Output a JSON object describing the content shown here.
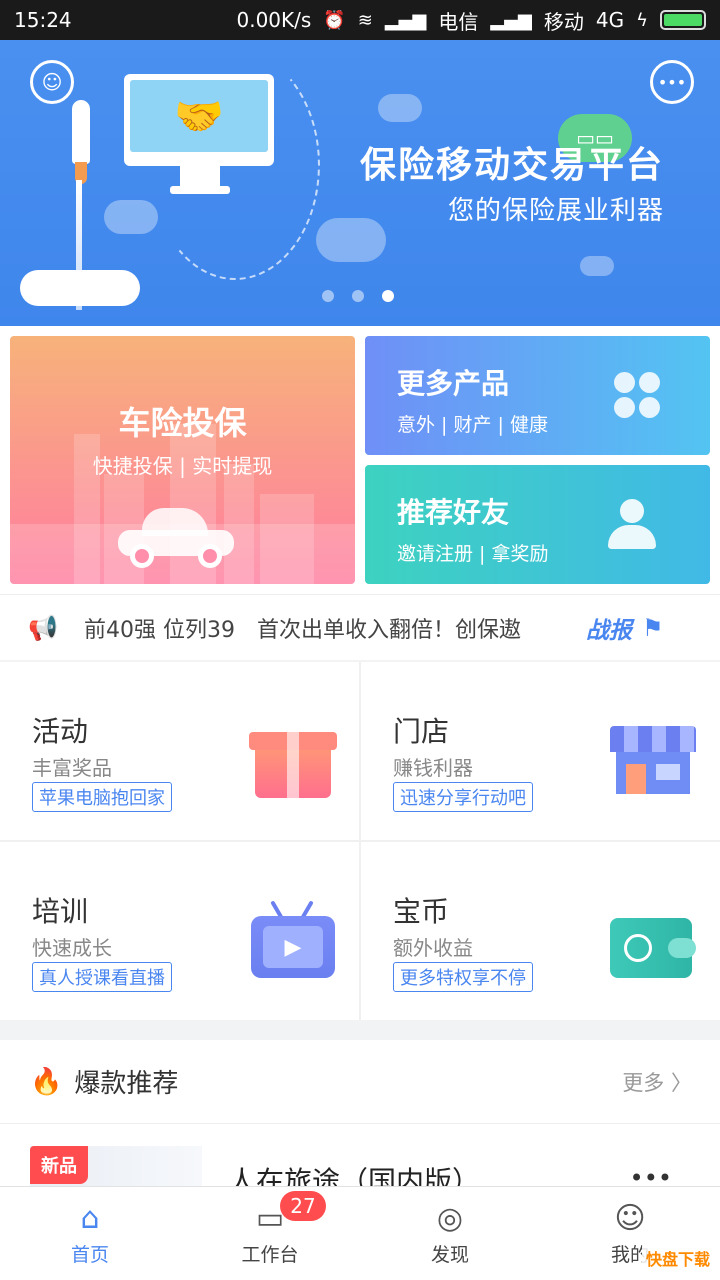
{
  "status_bar": {
    "time": "15:24",
    "speed": "0.00K/s",
    "carrier1": "电信",
    "carrier2": "移动",
    "network": "4G",
    "battery_level": 1.0
  },
  "banner": {
    "title": "保险移动交易平台",
    "subtitle": "您的保险展业利器",
    "page_count": 3,
    "active_page": 3
  },
  "tiles": {
    "car": {
      "title": "车险投保",
      "subtitle": "快捷投保 | 实时提现"
    },
    "more": {
      "title": "更多产品",
      "subtitle": "意外 | 财产 | 健康"
    },
    "friend": {
      "title": "推荐好友",
      "subtitle": "邀请注册 | 拿奖励"
    }
  },
  "news": {
    "text": "前40强 位列39　首次出单收入翻倍！创保遨",
    "tag": "战报"
  },
  "features": [
    {
      "title": "活动",
      "subtitle": "丰富奖品",
      "tag": "苹果电脑抱回家",
      "icon": "gift-icon"
    },
    {
      "title": "门店",
      "subtitle": "赚钱利器",
      "tag": "迅速分享行动吧",
      "icon": "store-icon"
    },
    {
      "title": "培训",
      "subtitle": "快速成长",
      "tag": "真人授课看直播",
      "icon": "tv-icon"
    },
    {
      "title": "宝币",
      "subtitle": "额外收益",
      "tag": "更多特权享不停",
      "icon": "wallet-icon"
    }
  ],
  "hot": {
    "title": "爆款推荐",
    "more": "更多 〉",
    "item": {
      "badge": "新品",
      "name": "人在旅途（国内版）",
      "menu": "•••"
    }
  },
  "tabbar": [
    {
      "label": "首页",
      "icon": "home-icon",
      "active": true
    },
    {
      "label": "工作台",
      "icon": "workbench-icon",
      "badge": "27"
    },
    {
      "label": "发现",
      "icon": "compass-icon"
    },
    {
      "label": "我的",
      "icon": "user-icon"
    }
  ],
  "watermark": "快盘下载",
  "colors": {
    "accent": "#4a86f0",
    "banner": "#4a90f0",
    "badge": "#ff4d4f"
  }
}
